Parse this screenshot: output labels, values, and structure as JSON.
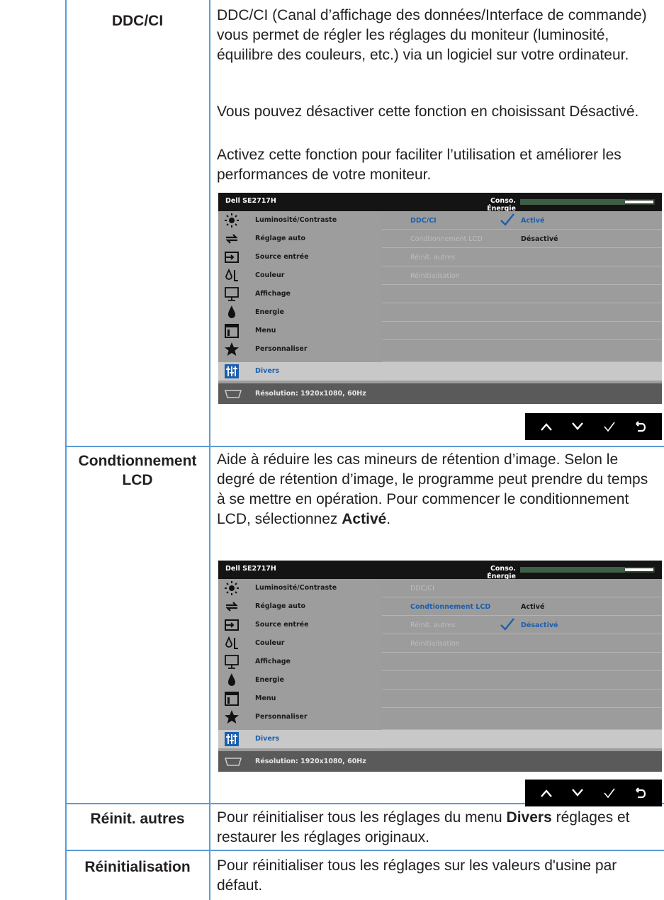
{
  "rows": [
    {
      "term": "DDC/CI",
      "paragraphs": [
        "DDC/CI (Canal d’affichage des données/Interface de commande) vous permet de régler les réglages du moniteur (luminosité, équilibre des couleurs, etc.) via un logiciel sur votre ordinateur.",
        "Vous pouvez désactiver cette fonction en choisissant Désactivé.",
        "Activez cette fonction pour faciliter l’utilisation et améliorer les performances de votre moniteur."
      ]
    },
    {
      "term": "Condtionnement LCD",
      "paragraph_parts": [
        "Aide à réduire les cas mineurs de rétention d’image. Selon le degré de rétention d’image, le programme peut prendre du temps à se mettre en opération. Pour commencer le conditionnement LCD, sélectionnez ",
        "Activé",
        "."
      ]
    },
    {
      "term": "Réinit. autres",
      "paragraph_parts": [
        "Pour réinitialiser tous les réglages du menu ",
        "Divers",
        " réglages et restaurer les réglages originaux."
      ]
    },
    {
      "term": "Réinitialisation",
      "paragraph": "Pour réinitialiser tous les réglages sur les valeurs d'usine par défaut."
    }
  ],
  "osd": {
    "model": "Dell SE2717H",
    "energy_label": "Conso. Énergie",
    "energy_level": 0.78,
    "menu": [
      {
        "label": "Luminosité/Contraste",
        "icon": "brightness-icon"
      },
      {
        "label": "Réglage auto",
        "icon": "auto-adjust-icon"
      },
      {
        "label": "Source entrée",
        "icon": "input-source-icon"
      },
      {
        "label": "Couleur",
        "icon": "color-icon"
      },
      {
        "label": "Affichage",
        "icon": "display-icon"
      },
      {
        "label": "Energie",
        "icon": "energy-icon"
      },
      {
        "label": "Menu",
        "icon": "menu-icon"
      },
      {
        "label": "Personnaliser",
        "icon": "star-icon"
      },
      {
        "label": "Divers",
        "icon": "others-icon"
      }
    ],
    "submenu": [
      "DDC/CI",
      "Condtionnement LCD",
      "Réinit. autres",
      "Réinitialisation"
    ],
    "resolution": "Résolution: 1920x1080, 60Hz",
    "screen1": {
      "active_item": "DDC/CI",
      "options": [
        "Activé",
        "Désactivé"
      ],
      "selected_option": "Activé"
    },
    "screen2": {
      "active_item": "Condtionnement LCD",
      "options": [
        "Activé",
        "Désactivé"
      ],
      "selected_option": "Désactivé"
    }
  },
  "colors": {
    "rule": "#5b9bd5",
    "osd_blue": "#1c5fad",
    "osd_gray": "#9d9d9d",
    "osd_selected": "#c8c8c8"
  },
  "nav_buttons": [
    "up-button",
    "down-button",
    "confirm-button",
    "back-button"
  ]
}
